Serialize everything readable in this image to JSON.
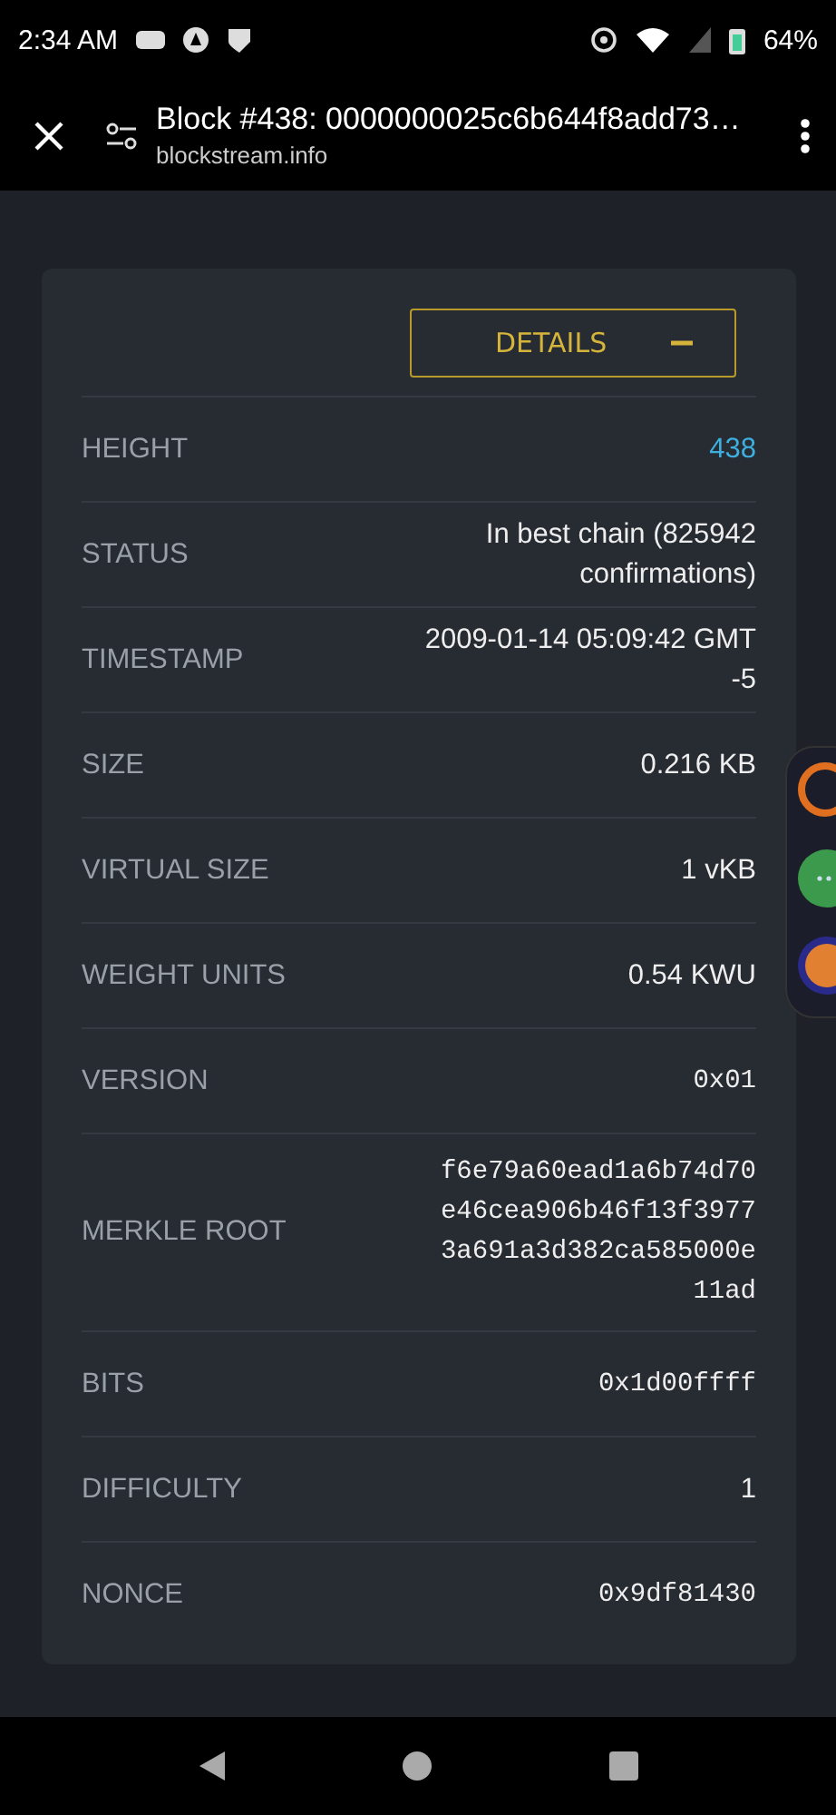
{
  "status_bar": {
    "time": "2:34 AM",
    "battery": "64%"
  },
  "toolbar": {
    "title": "Block #438: 0000000025c6b644f8add73…",
    "url": "blockstream.info"
  },
  "details_button": {
    "label": "DETAILS",
    "expanded": true
  },
  "rows": [
    {
      "label": "HEIGHT",
      "value": "438",
      "kind": "link"
    },
    {
      "label": "STATUS",
      "value": "In best chain (825942 confirmations)",
      "kind": "text"
    },
    {
      "label": "TIMESTAMP",
      "value": "2009-01-14 05:09:42 GMT -5",
      "kind": "text"
    },
    {
      "label": "SIZE",
      "value": "0.216 KB",
      "kind": "text"
    },
    {
      "label": "VIRTUAL SIZE",
      "value": "1 vKB",
      "kind": "text"
    },
    {
      "label": "WEIGHT UNITS",
      "value": "0.54 KWU",
      "kind": "text"
    },
    {
      "label": "VERSION",
      "value": "0x01",
      "kind": "mono"
    },
    {
      "label": "MERKLE ROOT",
      "value": "f6e79a60ead1a6b74d70e46cea906b46f13f39773a691a3d382ca585000e11ad",
      "kind": "hash"
    },
    {
      "label": "BITS",
      "value": "0x1d00ffff",
      "kind": "mono"
    },
    {
      "label": "DIFFICULTY",
      "value": "1",
      "kind": "text"
    },
    {
      "label": "NONCE",
      "value": "0x9df81430",
      "kind": "mono"
    }
  ]
}
